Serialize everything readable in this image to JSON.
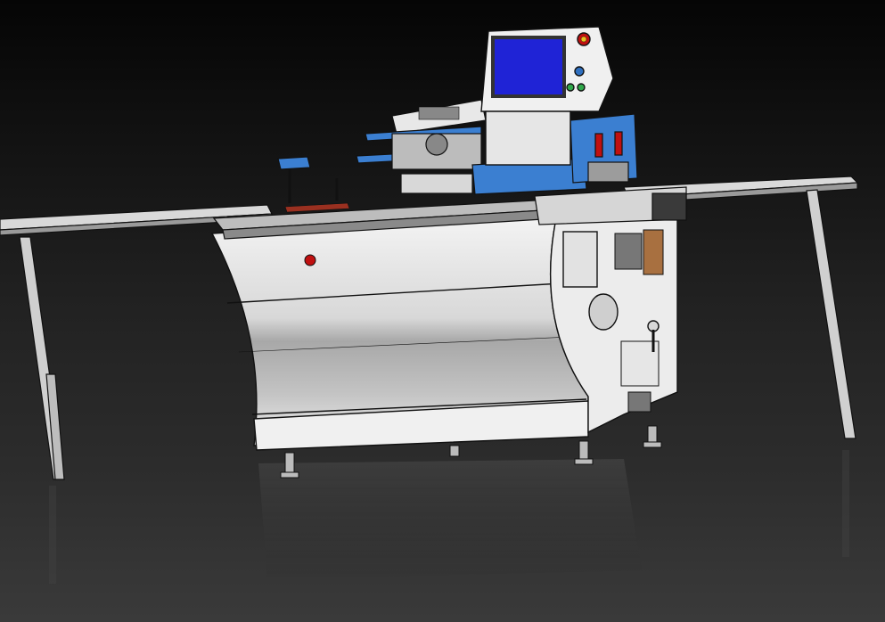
{
  "scene": {
    "subject": "machine-render",
    "colors": {
      "background_top": "#050505",
      "background_mid": "#2a2a2a",
      "floor": "#3a3a3a",
      "body_white": "#f2f2f2",
      "body_grey": "#bcbcbc",
      "accent_blue": "#3b7fd1",
      "screen_blue": "#1f23d6",
      "outline": "#111111",
      "stop_red": "#c01010"
    },
    "icons": [
      "control-panel-screen",
      "emergency-stop-button",
      "green-start-button",
      "blue-actuator-blocks",
      "support-legs"
    ]
  }
}
